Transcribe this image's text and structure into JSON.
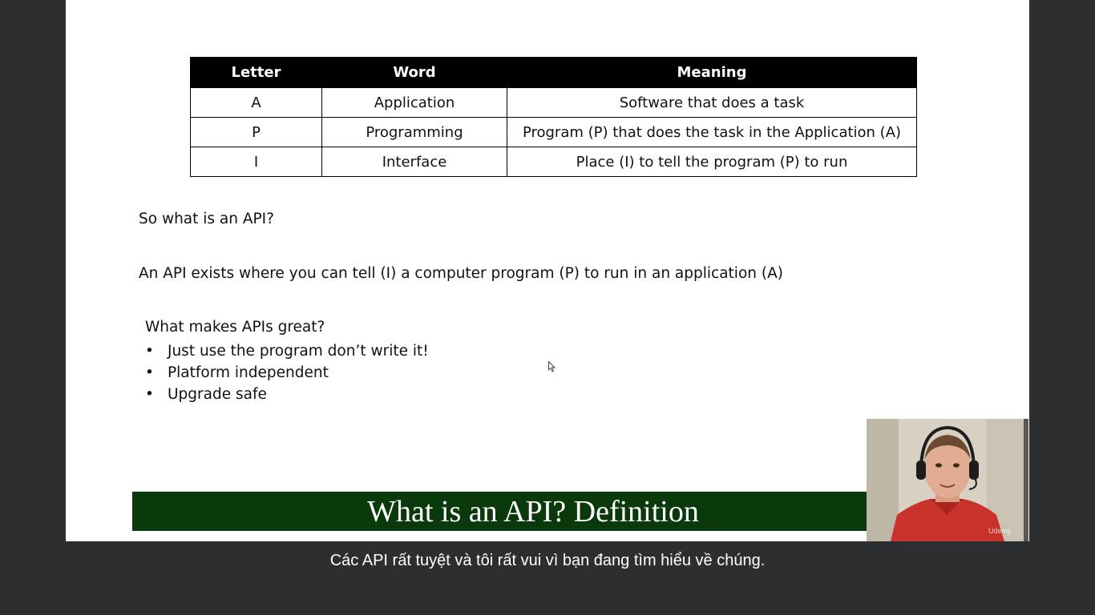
{
  "slide": {
    "table": {
      "headers": [
        "Letter",
        "Word",
        "Meaning"
      ],
      "rows": [
        [
          "A",
          "Application",
          "Software that does a task"
        ],
        [
          "P",
          "Programming",
          "Program (P) that does the task in the Application (A)"
        ],
        [
          "I",
          "Interface",
          "Place (I) to tell the program (P) to run"
        ]
      ]
    },
    "question": "So what is an API?",
    "definition": "An API exists where you can tell (I) a computer program (P) to run in an application (A)",
    "great_heading": "What makes APIs great?",
    "bullets": [
      "Just use the program don’t write it!",
      "Platform independent",
      "Upgrade safe"
    ],
    "bullet_char": "•",
    "title_bar": "What is an API?  Definition"
  },
  "webcam": {
    "watermark": "Udemy"
  },
  "caption": "Các API rất tuyệt và tôi rất vui vì bạn đang tìm hiểu về chúng.",
  "colors": {
    "background": "#2d2e30",
    "slide": "#ffffff",
    "table_header": "#000000",
    "title_bar": "#0a3a0c",
    "caption_text": "#ffffff"
  },
  "icons": {
    "cursor": "mouse-pointer-icon"
  }
}
